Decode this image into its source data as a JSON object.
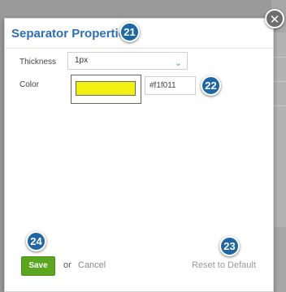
{
  "dialog": {
    "title": "Separator Properties",
    "close_icon": "close-icon"
  },
  "form": {
    "thickness": {
      "label": "Thickness",
      "value": "1px"
    },
    "color": {
      "label": "Color",
      "hex": "#f1f011",
      "swatch_color": "#f1f011"
    }
  },
  "footer": {
    "save_label": "Save",
    "or_text": "or",
    "cancel_label": "Cancel",
    "reset_label": "Reset to Default"
  },
  "badges": {
    "title_badge": "21",
    "color_badge": "22",
    "reset_badge": "23",
    "save_badge": "24"
  },
  "colors": {
    "title": "#2d6eb8",
    "badge": "#1e67a6",
    "save_button": "#5aa71f"
  }
}
